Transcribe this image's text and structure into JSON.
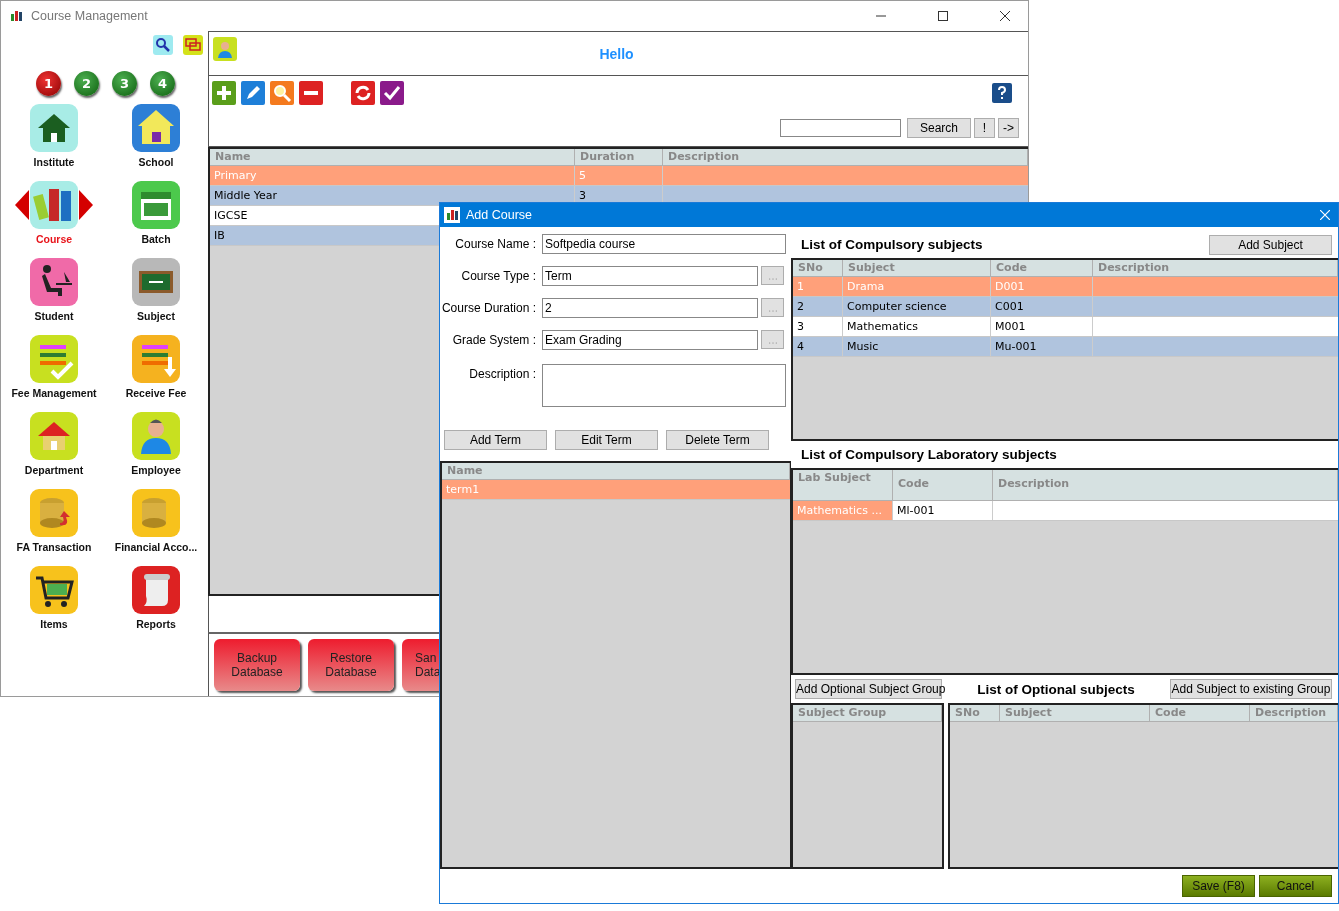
{
  "main_window": {
    "title": "Course Management"
  },
  "sidebar": {
    "pages": [
      {
        "label": "1",
        "selected": true
      },
      {
        "label": "2",
        "selected": false
      },
      {
        "label": "3",
        "selected": false
      },
      {
        "label": "4",
        "selected": false
      }
    ],
    "items": [
      {
        "label": "Institute",
        "selected": false
      },
      {
        "label": "School",
        "selected": false
      },
      {
        "label": "Course",
        "selected": true
      },
      {
        "label": "Batch",
        "selected": false
      },
      {
        "label": "Student",
        "selected": false
      },
      {
        "label": "Subject",
        "selected": false
      },
      {
        "label": "Fee Management",
        "selected": false
      },
      {
        "label": "Receive Fee",
        "selected": false
      },
      {
        "label": "Department",
        "selected": false
      },
      {
        "label": "Employee",
        "selected": false
      },
      {
        "label": "FA Transaction",
        "selected": false
      },
      {
        "label": "Financial Acco...",
        "selected": false
      },
      {
        "label": "Items",
        "selected": false
      },
      {
        "label": "Reports",
        "selected": false
      }
    ]
  },
  "header": {
    "greeting": "Hello"
  },
  "search": {
    "button": "Search",
    "extra_buttons": [
      "!",
      "->"
    ]
  },
  "courses_table": {
    "columns": [
      "Name",
      "Duration",
      "Description"
    ],
    "rows": [
      {
        "cells": [
          "Primary",
          "5"
        ],
        "selected": true
      },
      {
        "cells": [
          "Middle Year",
          "3"
        ],
        "selected": false
      },
      {
        "cells": [
          "IGCSE"
        ],
        "selected": false
      },
      {
        "cells": [
          "IB"
        ],
        "selected": false
      }
    ]
  },
  "bottom_buttons": [
    {
      "lines": [
        "Backup",
        "Database"
      ]
    },
    {
      "lines": [
        "Restore",
        "Database"
      ]
    },
    {
      "lines": [
        "San",
        "Data"
      ]
    }
  ],
  "dialog": {
    "title": "Add Course",
    "fields": [
      {
        "label": "Course Name :",
        "value": "Softpedia course",
        "kind": "text"
      },
      {
        "label": "Course Type :",
        "value": "Term",
        "kind": "picker"
      },
      {
        "label": "Course Duration :",
        "value": "2",
        "kind": "picker"
      },
      {
        "label": "Grade System :",
        "value": "Exam Grading",
        "kind": "picker"
      },
      {
        "label": "Description :",
        "kind": "area"
      }
    ],
    "term_buttons": [
      "Add Term",
      "Edit Term",
      "Delete Term"
    ],
    "terms_table": {
      "columns": [
        "Name"
      ],
      "rows": [
        {
          "cells": [
            "term1"
          ],
          "selected": true
        }
      ]
    },
    "compulsory": {
      "title": "List of Compulsory subjects",
      "button": "Add Subject",
      "columns": [
        "SNo",
        "Subject",
        "Code",
        "Description"
      ],
      "rows": [
        {
          "cells": [
            "1",
            "Drama",
            "D001"
          ],
          "selected": true
        },
        {
          "cells": [
            "2",
            "Computer science",
            "C001"
          ],
          "selected": false
        },
        {
          "cells": [
            "3",
            "Mathematics",
            "M001"
          ],
          "selected": false
        },
        {
          "cells": [
            "4",
            "Music",
            "Mu-001"
          ],
          "selected": false
        }
      ]
    },
    "laboratory": {
      "title": "List of Compulsory Laboratory subjects",
      "columns": [
        "Lab Subject",
        "Code",
        "Description"
      ],
      "rows": [
        {
          "cells": [
            "Mathematics ...",
            "Ml-001"
          ],
          "selected": true
        }
      ]
    },
    "optional": {
      "title": "List of Optional subjects",
      "group_button": "Add Optional Subject Group",
      "add_button": "Add Subject to existing Group",
      "group_columns": [
        "Subject Group"
      ],
      "columns": [
        "SNo",
        "Subject",
        "Code",
        "Description"
      ]
    },
    "actions": [
      "Save (F8)",
      "Cancel"
    ]
  }
}
